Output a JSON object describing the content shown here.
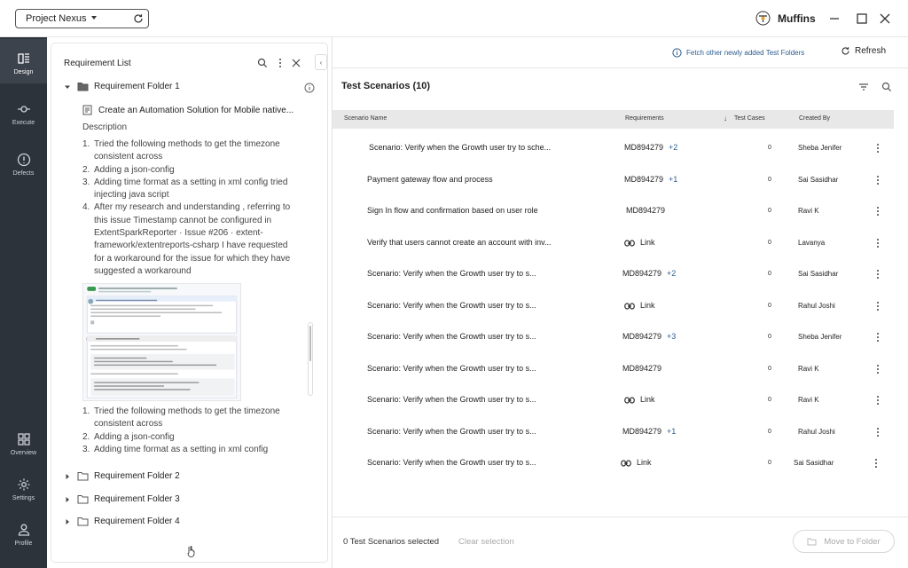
{
  "topbar": {
    "project_selector": "Project Nexus",
    "brand": "Muffins"
  },
  "sidenav": {
    "items": [
      {
        "label": "Design",
        "icon": "design-icon"
      },
      {
        "label": "Execute",
        "icon": "execute-icon"
      },
      {
        "label": "Defects",
        "icon": "defects-icon"
      },
      {
        "label": "Overview",
        "icon": "overview-icon"
      },
      {
        "label": "Settings",
        "icon": "settings-icon"
      },
      {
        "label": "Profile",
        "icon": "profile-icon"
      }
    ]
  },
  "requirements": {
    "title": "Requirement List",
    "folders": [
      {
        "label": "Requirement Folder 1"
      },
      {
        "label": "Requirement Folder 2"
      },
      {
        "label": "Requirement Folder 3"
      },
      {
        "label": "Requirement Folder 4"
      }
    ],
    "item_title": "Create an Automation Solution for Mobile native...",
    "description_label": "Description",
    "steps_a": [
      {
        "num": "1.",
        "text": "Tried the following methods to get the timezone consistent across"
      },
      {
        "num": "2.",
        "text": "Adding a json-config"
      },
      {
        "num": "3.",
        "text": "Adding time format as a setting in xml config tried injecting java script"
      },
      {
        "num": "4.",
        "text": "After my research and understanding , referring to this issue Timestamp cannot be configured in ExtentSparkReporter · Issue #206 · extent-framework/extentreports-csharp I have requested for a workaround for the issue for which they have suggested a workaround"
      }
    ],
    "steps_b": [
      {
        "num": "1.",
        "text": "Tried the following methods to get the timezone consistent across"
      },
      {
        "num": "2.",
        "text": "Adding a json-config"
      },
      {
        "num": "3.",
        "text": "Adding time format as a setting in xml config"
      }
    ]
  },
  "main": {
    "fetch_link": "Fetch other newly added Test Folders",
    "refresh_label": "Refresh",
    "title": "Test Scenarios (10)",
    "columns": {
      "name": "Scenario Name",
      "requirements": "Requirements",
      "test_cases": "Test Cases",
      "created_by": "Created By"
    },
    "rows": [
      {
        "name": "Scenario: Verify when the Growth user try to sche...",
        "req": "MD894279",
        "plus": "+2",
        "link": false,
        "cases": "0",
        "creator": "Sheba Jenifer"
      },
      {
        "name": "Payment gateway flow and process",
        "req": "MD894279",
        "plus": "+1",
        "link": false,
        "cases": "0",
        "creator": "Sai Sasidhar"
      },
      {
        "name": "Sign In flow and confirmation based on user role",
        "req": "MD894279",
        "plus": "",
        "link": false,
        "cases": "0",
        "creator": "Ravi K"
      },
      {
        "name": "Verify that users cannot create an account with inv...",
        "req": "Link",
        "plus": "",
        "link": true,
        "cases": "0",
        "creator": "Lavanya"
      },
      {
        "name": "Scenario: Verify when the Growth user try to s...",
        "req": "MD894279",
        "plus": "+2",
        "link": false,
        "cases": "0",
        "creator": "Sai Sasidhar"
      },
      {
        "name": "Scenario: Verify when the Growth user try to s...",
        "req": "Link",
        "plus": "",
        "link": true,
        "cases": "0",
        "creator": "Rahul Joshi"
      },
      {
        "name": "Scenario: Verify when the Growth user try to s...",
        "req": "MD894279",
        "plus": "+3",
        "link": false,
        "cases": "0",
        "creator": "Sheba Jenifer"
      },
      {
        "name": "Scenario: Verify when the Growth user try to s...",
        "req": "MD894279",
        "plus": "",
        "link": false,
        "cases": "0",
        "creator": "Ravi K"
      },
      {
        "name": "Scenario: Verify when the Growth user try to s...",
        "req": "Link",
        "plus": "",
        "link": true,
        "cases": "0",
        "creator": "Ravi K"
      },
      {
        "name": "Scenario: Verify when the Growth user try to s...",
        "req": "MD894279",
        "plus": "+1",
        "link": false,
        "cases": "0",
        "creator": "Rahul Joshi"
      },
      {
        "name": "Scenario: Verify when the Growth user try to s...",
        "req": "Link",
        "plus": "",
        "link": true,
        "cases": "0",
        "creator": "Sai Sasidhar"
      }
    ],
    "selected_count": "0 Test Scenarios selected",
    "clear_selection": "Clear selection",
    "move_to_folder": "Move to Folder"
  },
  "colors": {
    "sidenav_bg": "#2d333b",
    "accent": "#2c5c8f",
    "table_header_bg": "#e8e8e8"
  }
}
